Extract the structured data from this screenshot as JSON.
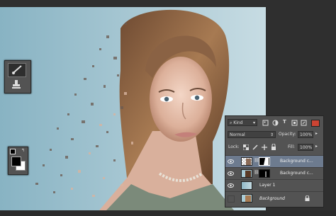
{
  "layers_panel": {
    "filter": {
      "value": "Kind"
    },
    "blend_mode": "Normal",
    "opacity_label": "Opacity:",
    "opacity_value": "100%",
    "lock_label": "Lock:",
    "fill_label": "Fill:",
    "fill_value": "100%",
    "layers": [
      {
        "name": "Background c...",
        "selected": true,
        "visible": true
      },
      {
        "name": "Background c...",
        "selected": false,
        "visible": true
      },
      {
        "name": "Layer 1",
        "selected": false,
        "visible": true
      },
      {
        "name": "Background",
        "selected": false,
        "visible": false,
        "locked": true
      }
    ]
  },
  "colors": {
    "panel_bg": "#535353",
    "selected_layer": "#6d7b8f",
    "canvas_bg": "#a9cbd6"
  }
}
